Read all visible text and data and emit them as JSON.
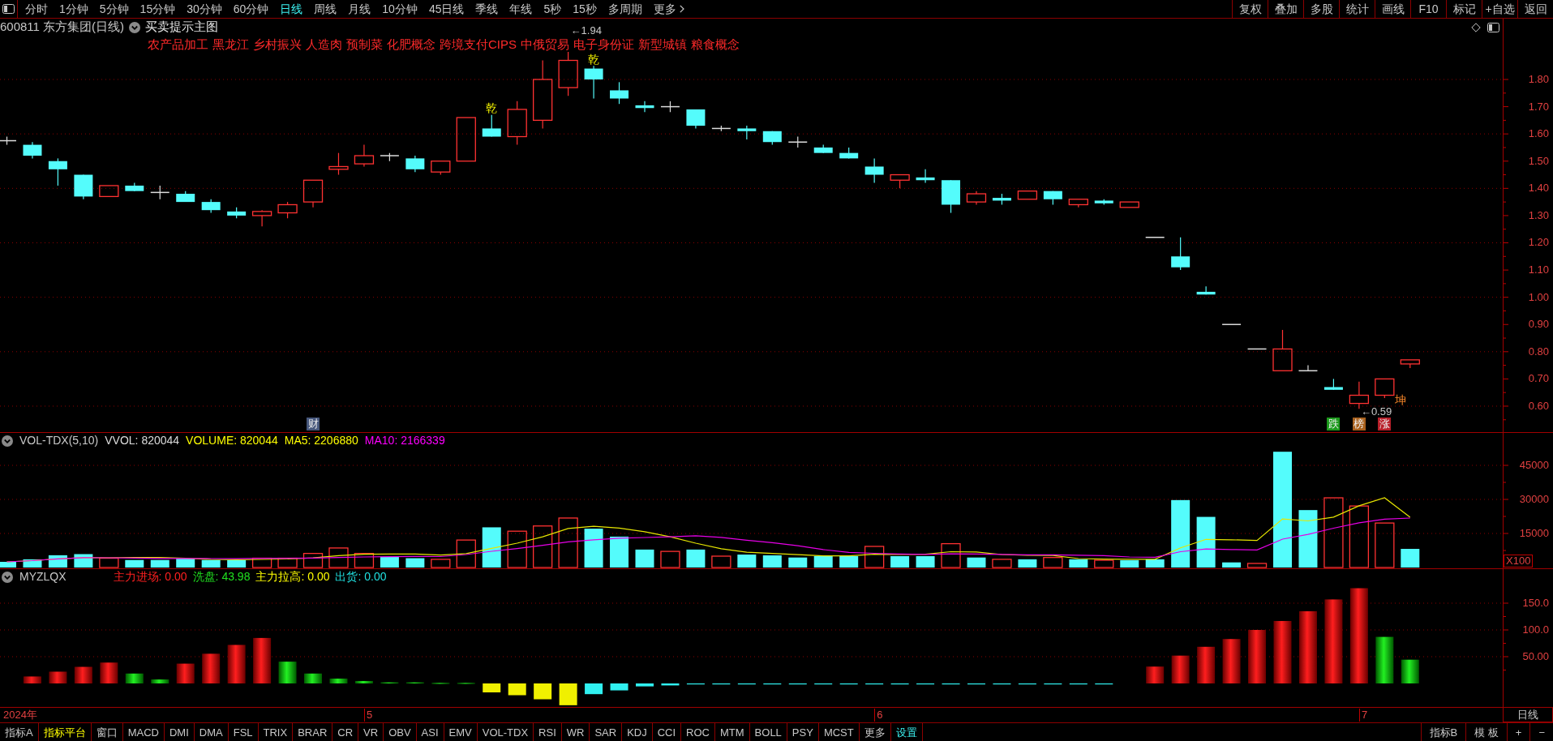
{
  "toolbar": {
    "periods": [
      {
        "label": "分时",
        "selected": false
      },
      {
        "label": "1分钟",
        "selected": false
      },
      {
        "label": "5分钟",
        "selected": false
      },
      {
        "label": "15分钟",
        "selected": false
      },
      {
        "label": "30分钟",
        "selected": false
      },
      {
        "label": "60分钟",
        "selected": false
      },
      {
        "label": "日线",
        "selected": true
      },
      {
        "label": "周线",
        "selected": false
      },
      {
        "label": "月线",
        "selected": false
      },
      {
        "label": "10分钟",
        "selected": false
      },
      {
        "label": "45日线",
        "selected": false
      },
      {
        "label": "季线",
        "selected": false
      },
      {
        "label": "年线",
        "selected": false
      },
      {
        "label": "5秒",
        "selected": false
      },
      {
        "label": "15秒",
        "selected": false
      },
      {
        "label": "多周期",
        "selected": false
      }
    ],
    "more": "更多",
    "actions": [
      "复权",
      "叠加",
      "多股",
      "统计",
      "画线",
      "F10",
      "标记",
      "+自选",
      "返回"
    ]
  },
  "price_panel": {
    "symbol": "600811 东方集团(日线)",
    "template": "买卖提示主图",
    "concepts": [
      "农产品加工",
      "黑龙江",
      "乡村振兴",
      "人造肉",
      "预制菜",
      "化肥概念",
      "跨境支付CIPS",
      "中俄贸易",
      "电子身份证",
      "新型城镇",
      "粮食概念"
    ],
    "axis_labels": [
      "1.80",
      "1.70",
      "1.60",
      "1.50",
      "1.40",
      "1.30",
      "1.20",
      "1.10",
      "1.00",
      "0.90",
      "0.80",
      "0.70",
      "0.60"
    ],
    "high_label": "←1.94",
    "low_label": "←0.59",
    "signals": [
      {
        "text": "乾",
        "color": "#ffff00"
      },
      {
        "text": "乾",
        "color": "#ffff00"
      },
      {
        "text": "坤",
        "color": "#ff8a2a"
      }
    ],
    "markers": [
      {
        "text": "财",
        "color": "#46577c"
      },
      {
        "text": "跌",
        "color": "#1c9a1c"
      },
      {
        "text": "榜",
        "color": "#a8601c"
      },
      {
        "text": "涨",
        "color": "#b8202a"
      }
    ]
  },
  "volume_panel": {
    "name": "VOL-TDX(5,10)",
    "readings": [
      {
        "text": "VVOL: 820044",
        "color": "#dcdcdc"
      },
      {
        "text": "VOLUME: 820044",
        "color": "#ffff00"
      },
      {
        "text": "MA5: 2206880",
        "color": "#ffff00"
      },
      {
        "text": "MA10: 2166339",
        "color": "#ff00ff"
      }
    ],
    "axis_labels": [
      "45000",
      "30000",
      "15000"
    ],
    "unit": "X100"
  },
  "indicator_panel": {
    "name": "MYZLQX",
    "readings": [
      {
        "text": "主力进场: 0.00",
        "color": "#ff2020"
      },
      {
        "text": "洗盘: 43.98",
        "color": "#20e020"
      },
      {
        "text": "主力拉高: 0.00",
        "color": "#ffff00"
      },
      {
        "text": "出货: 0.00",
        "color": "#20e0e0"
      }
    ],
    "axis_labels": [
      "150.0",
      "100.0",
      "50.00"
    ]
  },
  "date_axis": {
    "labels": [
      "2024年",
      "5",
      "6",
      "7"
    ],
    "period": "日线"
  },
  "bottom_bar": {
    "tabs": [
      {
        "label": "指标A",
        "kind": "tab",
        "selected": false
      },
      {
        "label": "指标平台",
        "kind": "tab",
        "selected": true
      },
      {
        "label": "窗口",
        "kind": "tab",
        "selected": false
      },
      {
        "label": "MACD",
        "kind": "tab",
        "selected": false
      },
      {
        "label": "DMI",
        "kind": "tab",
        "selected": false
      },
      {
        "label": "DMA",
        "kind": "tab",
        "selected": false
      },
      {
        "label": "FSL",
        "kind": "tab",
        "selected": false
      },
      {
        "label": "TRIX",
        "kind": "tab",
        "selected": false
      },
      {
        "label": "BRAR",
        "kind": "tab",
        "selected": false
      },
      {
        "label": "CR",
        "kind": "tab",
        "selected": false
      },
      {
        "label": "VR",
        "kind": "tab",
        "selected": false
      },
      {
        "label": "OBV",
        "kind": "tab",
        "selected": false
      },
      {
        "label": "ASI",
        "kind": "tab",
        "selected": false
      },
      {
        "label": "EMV",
        "kind": "tab",
        "selected": false
      },
      {
        "label": "VOL-TDX",
        "kind": "tab",
        "selected": false
      },
      {
        "label": "RSI",
        "kind": "tab",
        "selected": false
      },
      {
        "label": "WR",
        "kind": "tab",
        "selected": false
      },
      {
        "label": "SAR",
        "kind": "tab",
        "selected": false
      },
      {
        "label": "KDJ",
        "kind": "tab",
        "selected": false
      },
      {
        "label": "CCI",
        "kind": "tab",
        "selected": false
      },
      {
        "label": "ROC",
        "kind": "tab",
        "selected": false
      },
      {
        "label": "MTM",
        "kind": "tab",
        "selected": false
      },
      {
        "label": "BOLL",
        "kind": "tab",
        "selected": false
      },
      {
        "label": "PSY",
        "kind": "tab",
        "selected": false
      },
      {
        "label": "MCST",
        "kind": "tab",
        "selected": false
      },
      {
        "label": "更多",
        "kind": "tab",
        "selected": false
      },
      {
        "label": "设置",
        "kind": "settings",
        "selected": false
      }
    ],
    "right": [
      "指标B",
      "模 板",
      "+",
      "−"
    ]
  }
}
